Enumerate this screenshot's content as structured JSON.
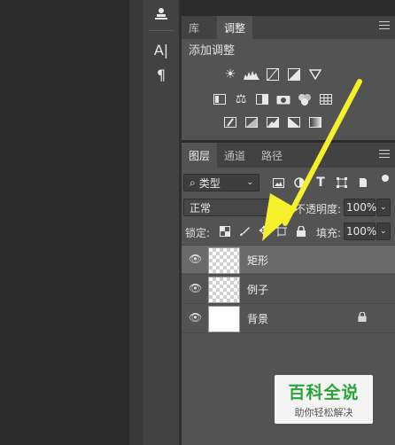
{
  "app": {
    "library_tab": "库",
    "adjustments_tab": "调整"
  },
  "adjustments": {
    "title": "添加调整"
  },
  "layers_panel": {
    "tabs": [
      "图层",
      "通道",
      "路径"
    ],
    "filter": {
      "label": "类型"
    },
    "blend_mode": "正常",
    "opacity_label": "不透明度:",
    "opacity_value": "100%",
    "lock_label": "锁定:",
    "fill_label": "填充:",
    "fill_value": "100%",
    "layers": [
      {
        "name": "矩形",
        "selected": true
      },
      {
        "name": "例子",
        "selected": false
      },
      {
        "name": "背景",
        "selected": false,
        "locked": true
      }
    ]
  },
  "tool_strip": {
    "char_icon": "A|",
    "para_icon": "¶"
  },
  "annotation": {
    "arrow_color": "#f5f02a"
  },
  "watermark": {
    "title": "百科全说",
    "subtitle": "助你轻松解决"
  }
}
